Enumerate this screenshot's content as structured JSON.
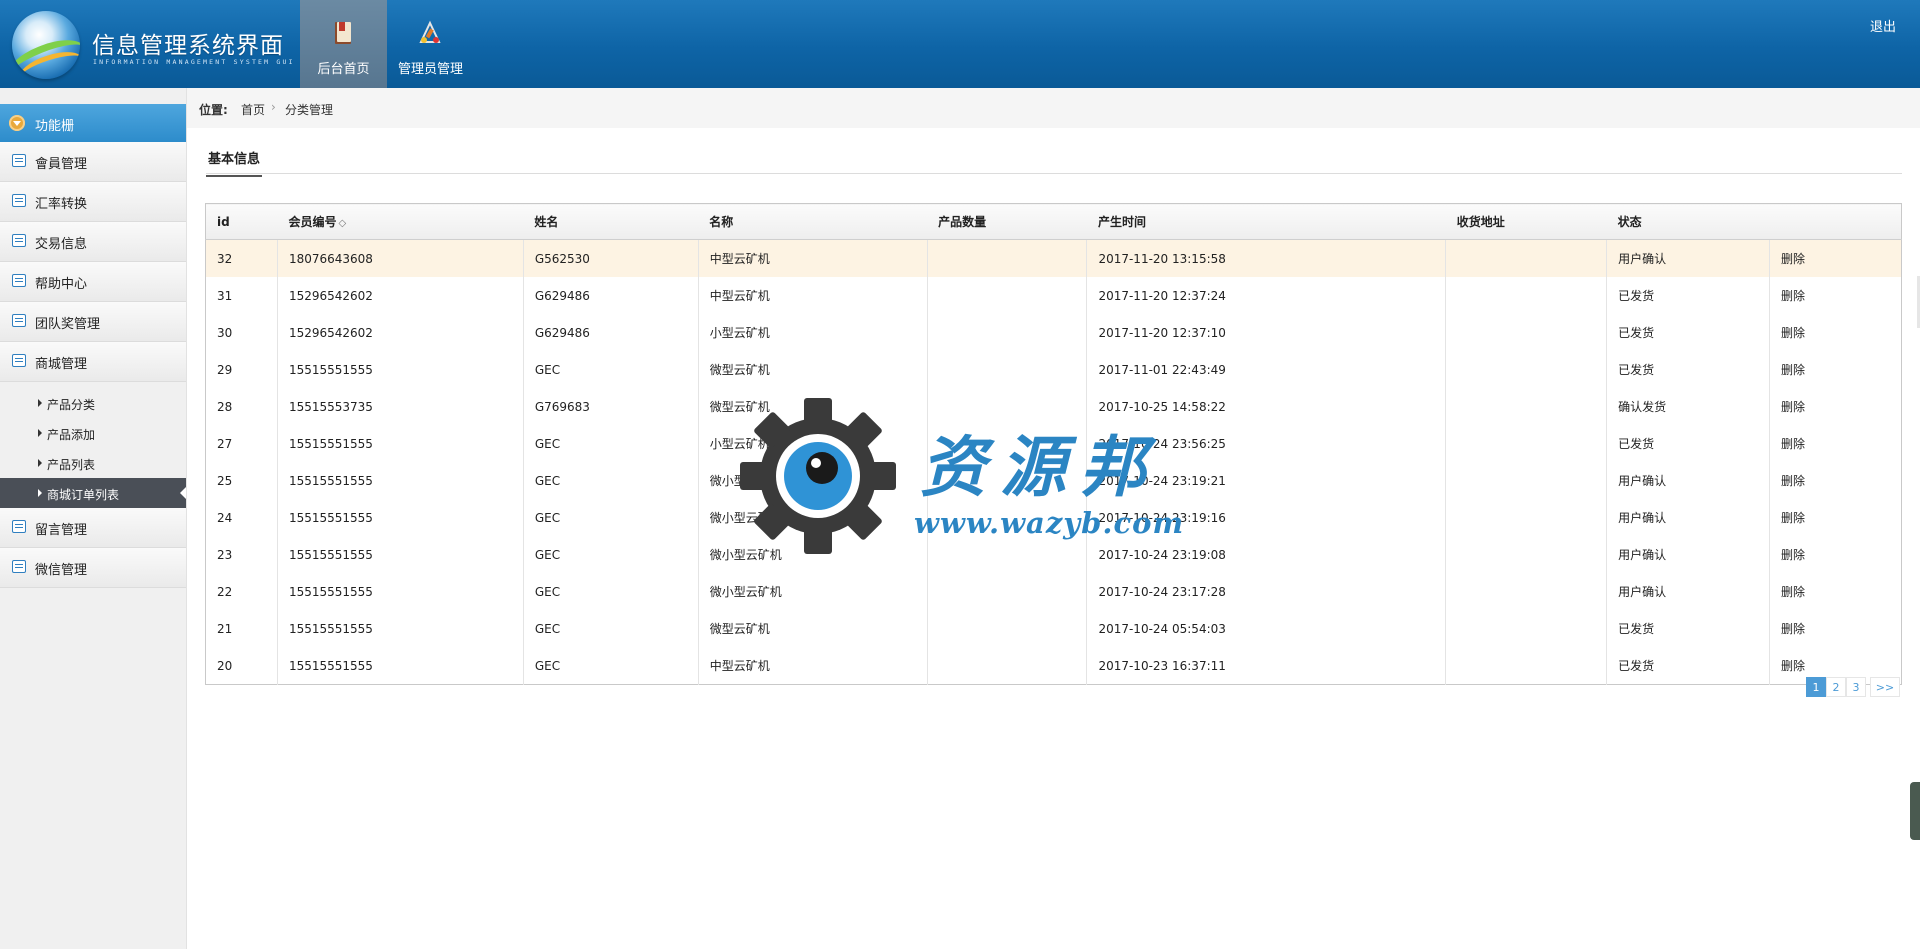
{
  "header": {
    "title": "信息管理系统界面",
    "subtitle": "INFORMATION MANAGEMENT SYSTEM GUI",
    "nav": [
      {
        "label": "后台首页",
        "icon": "book-icon",
        "active": true
      },
      {
        "label": "管理员管理",
        "icon": "admin-tools-icon",
        "active": false
      }
    ],
    "logout": "退出"
  },
  "sidebar": {
    "header": "功能栅",
    "items": [
      {
        "label": "會員管理",
        "icon": "list-icon"
      },
      {
        "label": "汇率转换",
        "icon": "chat-icon"
      },
      {
        "label": "交易信息",
        "icon": "list-icon"
      },
      {
        "label": "帮助中心",
        "icon": "edit-icon"
      },
      {
        "label": "团队奖管理",
        "icon": "calendar-icon"
      },
      {
        "label": "商城管理",
        "icon": "calendar-icon"
      }
    ],
    "subitems": [
      {
        "label": "产品分类",
        "active": false
      },
      {
        "label": "产品添加",
        "active": false
      },
      {
        "label": "产品列表",
        "active": false
      },
      {
        "label": "商城订单列表",
        "active": true
      }
    ],
    "items_after": [
      {
        "label": "留言管理",
        "icon": "edit-icon"
      },
      {
        "label": "微信管理",
        "icon": "chat-icon"
      }
    ]
  },
  "breadcrumb": {
    "label": "位置:",
    "crumbs": [
      "首页",
      "分类管理"
    ],
    "separator": "›"
  },
  "section": {
    "title": "基本信息"
  },
  "table": {
    "headers": [
      "id",
      "会员编号",
      "姓名",
      "名称",
      "产品数量",
      "产生时间",
      "收货地址",
      "状态",
      ""
    ],
    "sort_icon": "◇",
    "rows": [
      {
        "id": "32",
        "member": "18076643608",
        "name": "G562530",
        "product": "中型云矿机",
        "qty": "",
        "time": "2017-11-20 13:15:58",
        "addr": "",
        "status": "用户确认",
        "action": "删除"
      },
      {
        "id": "31",
        "member": "15296542602",
        "name": "G629486",
        "product": "中型云矿机",
        "qty": "",
        "time": "2017-11-20 12:37:24",
        "addr": "",
        "status": "已发货",
        "action": "删除"
      },
      {
        "id": "30",
        "member": "15296542602",
        "name": "G629486",
        "product": "小型云矿机",
        "qty": "",
        "time": "2017-11-20 12:37:10",
        "addr": "",
        "status": "已发货",
        "action": "删除"
      },
      {
        "id": "29",
        "member": "15515551555",
        "name": "GEC",
        "product": "微型云矿机",
        "qty": "",
        "time": "2017-11-01 22:43:49",
        "addr": "",
        "status": "已发货",
        "action": "删除"
      },
      {
        "id": "28",
        "member": "15515553735",
        "name": "G769683",
        "product": "微型云矿机",
        "qty": "",
        "time": "2017-10-25 14:58:22",
        "addr": "",
        "status": "确认发货",
        "action": "删除"
      },
      {
        "id": "27",
        "member": "15515551555",
        "name": "GEC",
        "product": "小型云矿机",
        "qty": "",
        "time": "2017-10-24 23:56:25",
        "addr": "",
        "status": "已发货",
        "action": "删除"
      },
      {
        "id": "25",
        "member": "15515551555",
        "name": "GEC",
        "product": "微小型云矿机",
        "qty": "",
        "time": "2017-10-24 23:19:21",
        "addr": "",
        "status": "用户确认",
        "action": "删除"
      },
      {
        "id": "24",
        "member": "15515551555",
        "name": "GEC",
        "product": "微小型云矿机",
        "qty": "",
        "time": "2017-10-24 23:19:16",
        "addr": "",
        "status": "用户确认",
        "action": "删除"
      },
      {
        "id": "23",
        "member": "15515551555",
        "name": "GEC",
        "product": "微小型云矿机",
        "qty": "",
        "time": "2017-10-24 23:19:08",
        "addr": "",
        "status": "用户确认",
        "action": "删除"
      },
      {
        "id": "22",
        "member": "15515551555",
        "name": "GEC",
        "product": "微小型云矿机",
        "qty": "",
        "time": "2017-10-24 23:17:28",
        "addr": "",
        "status": "用户确认",
        "action": "删除"
      },
      {
        "id": "21",
        "member": "15515551555",
        "name": "GEC",
        "product": "微型云矿机",
        "qty": "",
        "time": "2017-10-24 05:54:03",
        "addr": "",
        "status": "已发货",
        "action": "删除"
      },
      {
        "id": "20",
        "member": "15515551555",
        "name": "GEC",
        "product": "中型云矿机",
        "qty": "",
        "time": "2017-10-23 16:37:11",
        "addr": "",
        "status": "已发货",
        "action": "删除"
      }
    ]
  },
  "pagination": {
    "pages": [
      "1",
      "2",
      "3"
    ],
    "next": ">>",
    "current": "1"
  },
  "watermark": {
    "brand": "资源邦",
    "url": "www.wazyb.com"
  },
  "colors": {
    "header_blue": "#0e64a6",
    "accent_blue": "#2d8ccb",
    "highlight_row": "#fdf3e3",
    "active_sub": "#4a4f57"
  }
}
